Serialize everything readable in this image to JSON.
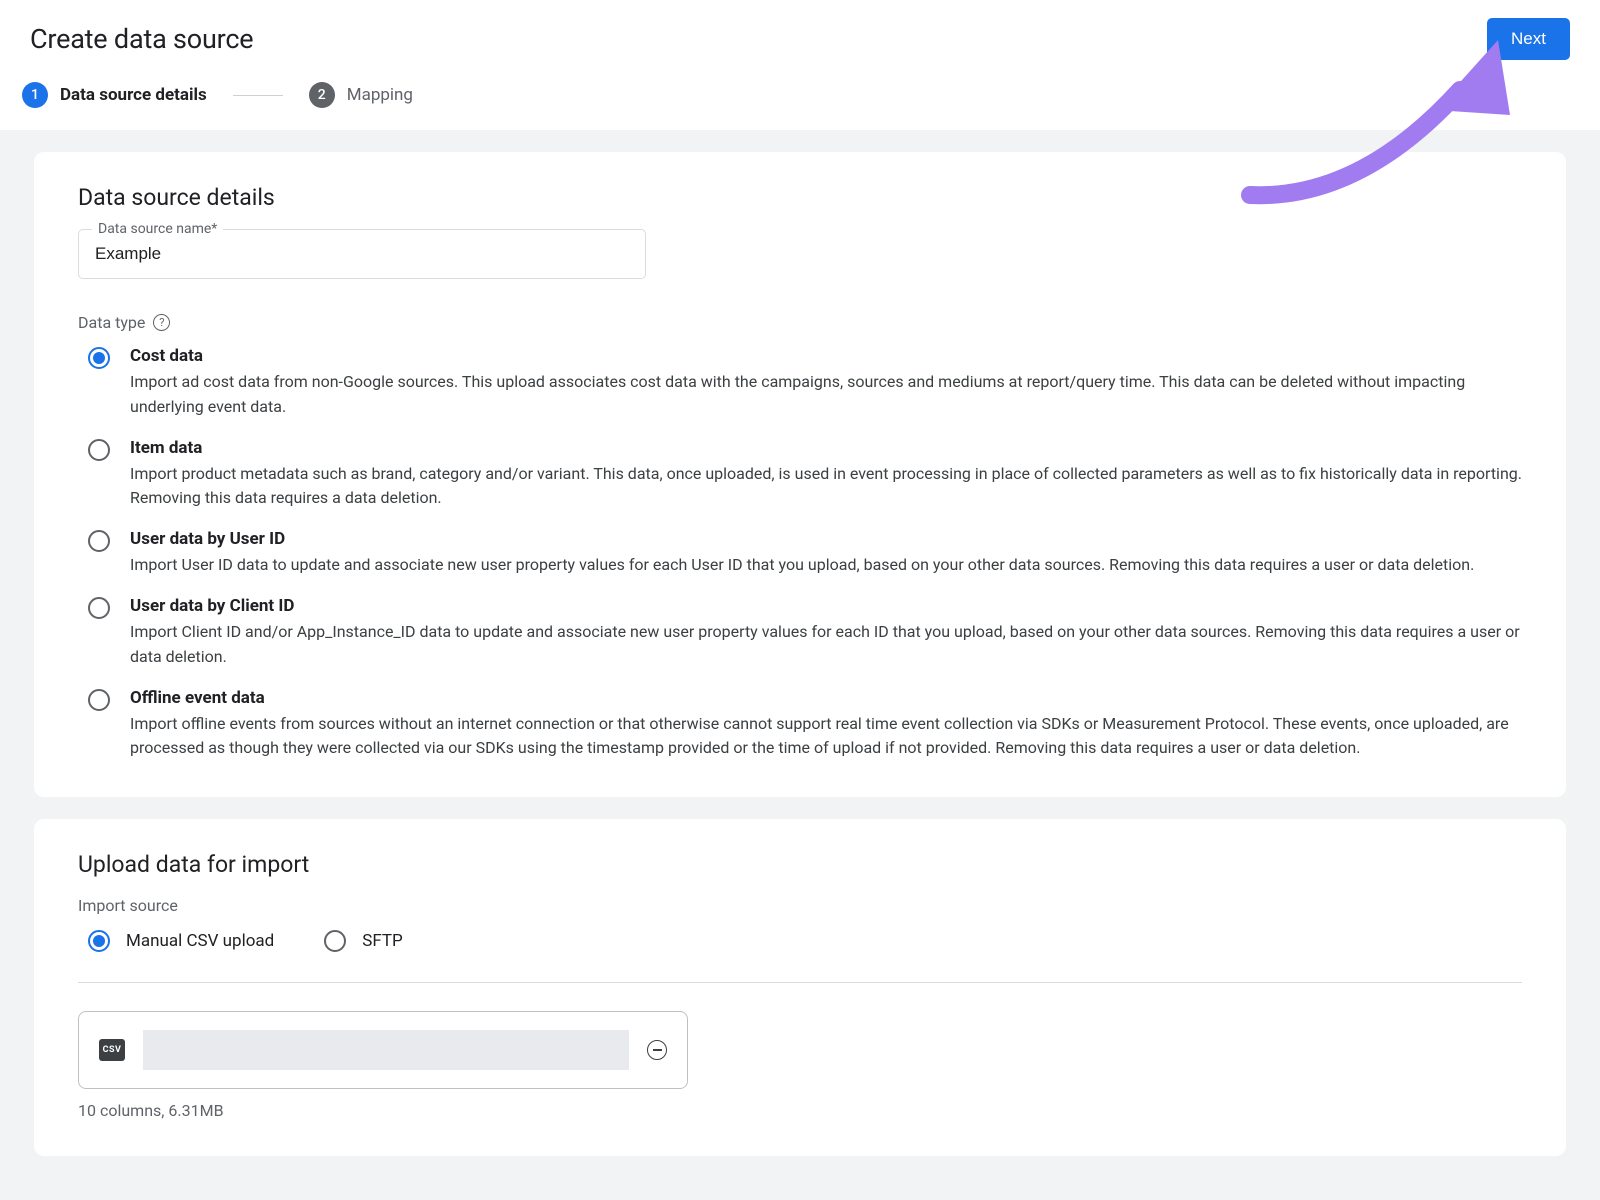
{
  "header": {
    "title": "Create data source",
    "next_label": "Next"
  },
  "stepper": {
    "step1_num": "1",
    "step1_label": "Data source details",
    "step2_num": "2",
    "step2_label": "Mapping"
  },
  "details": {
    "card_title": "Data source details",
    "name_label": "Data source name*",
    "name_value": "Example",
    "data_type_label": "Data type",
    "options": [
      {
        "title": "Cost data",
        "desc": "Import ad cost data from non-Google sources. This upload associates cost data with the campaigns, sources and mediums at report/query time. This data can be deleted without impacting underlying event data.",
        "selected": true
      },
      {
        "title": "Item data",
        "desc": "Import product metadata such as brand, category and/or variant. This data, once uploaded, is used in event processing in place of collected parameters as well as to fix historically data in reporting. Removing this data requires a data deletion.",
        "selected": false
      },
      {
        "title": "User data by User ID",
        "desc": "Import User ID data to update and associate new user property values for each User ID that you upload, based on your other data sources. Removing this data requires a user or data deletion.",
        "selected": false
      },
      {
        "title": "User data by Client ID",
        "desc": "Import Client ID and/or App_Instance_ID data to update and associate new user property values for each ID that you upload, based on your other data sources. Removing this data requires a user or data deletion.",
        "selected": false
      },
      {
        "title": "Offline event data",
        "desc": "Import offline events from sources without an internet connection or that otherwise cannot support real time event collection via SDKs or Measurement Protocol. These events, once uploaded, are processed as though they were collected via our SDKs using the timestamp provided or the time of upload if not provided. Removing this data requires a user or data deletion.",
        "selected": false
      }
    ]
  },
  "upload": {
    "card_title": "Upload data for import",
    "import_source_label": "Import source",
    "manual_label": "Manual CSV upload",
    "sftp_label": "SFTP",
    "csv_icon_label": "CSV",
    "file_meta": "10 columns, 6.31MB"
  }
}
